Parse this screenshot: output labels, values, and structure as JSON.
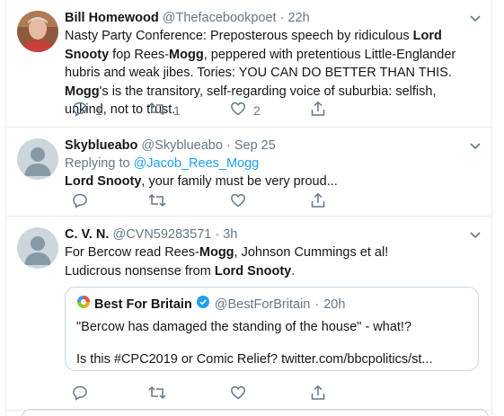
{
  "tweets": [
    {
      "name": "Bill Homewood",
      "handle": "@Thefacebookpoet",
      "sep": "·",
      "time": "22h",
      "body": [
        {
          "t": "Nasty Party Conference: Preposterous speech by ridiculous "
        },
        {
          "t": "Lord Snooty",
          "b": true
        },
        {
          "t": " fop Rees-"
        },
        {
          "t": "Mogg",
          "b": true
        },
        {
          "t": ", peppered with pretentious Little-Englander hubris and weak jibes. Tories: YOU CAN DO BETTER THAN THIS. "
        },
        {
          "t": "Mogg",
          "b": true
        },
        {
          "t": "'s is the transitory, self-regarding voice of suburbia: selfish, unkind, not to trust."
        }
      ],
      "reply_count": "1",
      "retweet_count": "1",
      "like_count": "2"
    },
    {
      "name": "Skyblueabo",
      "handle": "@Skyblueabo",
      "sep": "·",
      "time": "Sep 25",
      "replying_prefix": "Replying to ",
      "replying_to": "@Jacob_Rees_Mogg",
      "body": [
        {
          "t": "Lord Snooty",
          "b": true
        },
        {
          "t": ", your family must be very proud..."
        }
      ],
      "reply_count": "",
      "retweet_count": "",
      "like_count": ""
    },
    {
      "name": "C. V. N.",
      "handle": "@CVN59283571",
      "sep": "·",
      "time": "3h",
      "body": [
        {
          "t": "For Bercow read Rees-"
        },
        {
          "t": "Mogg",
          "b": true
        },
        {
          "t": ", Johnson Cummings et al!\nLudicrous nonsense from "
        },
        {
          "t": "Lord Snooty",
          "b": true
        },
        {
          "t": "."
        }
      ],
      "quote": {
        "name": "Best For Britain",
        "handle": "@BestForBritain",
        "sep": "·",
        "time": "20h",
        "line1": "\"Bercow has damaged the standing of the house\" - what!?",
        "line2": "Is this #CPC2019 or Comic Relief? twitter.com/bbcpolitics/st..."
      },
      "reply_count": "",
      "retweet_count": "",
      "like_count": ""
    }
  ],
  "icons": {
    "reply": "reply-icon",
    "retweet": "retweet-icon",
    "like": "heart-icon",
    "share": "share-icon",
    "caret": "chevron-down-icon",
    "verified": "verified-badge-icon"
  },
  "colors": {
    "accent": "#1da1f2",
    "muted": "#657786",
    "border": "#e6ecf0"
  }
}
